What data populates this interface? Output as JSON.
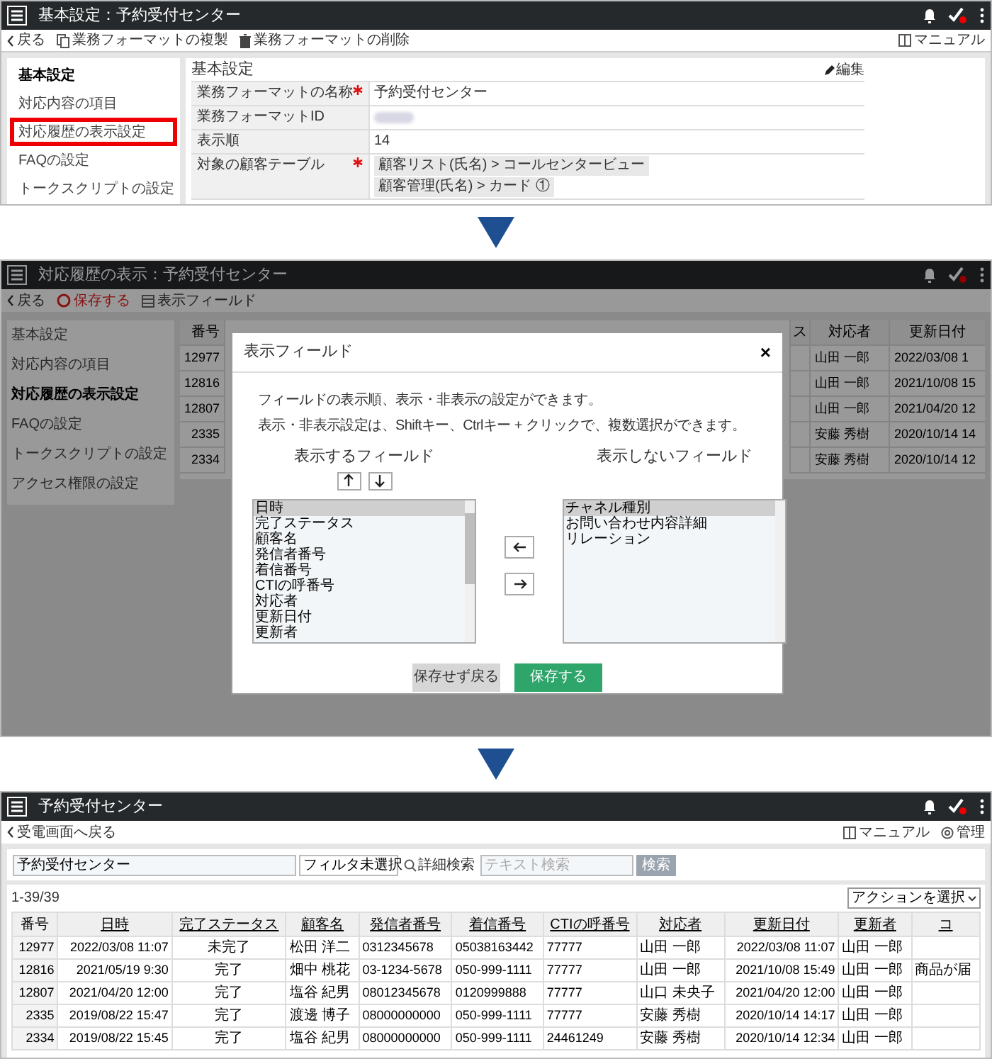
{
  "settings_screen": {
    "title": "基本設定：予約受付センター",
    "toolbar": [
      {
        "label": "戻る",
        "kind": "back"
      },
      {
        "label": "業務フォーマットの複製",
        "kind": "copy"
      },
      {
        "label": "業務フォーマットの削除",
        "kind": "delete"
      }
    ],
    "manual_link": "マニュアル",
    "sidebar": [
      {
        "label": "基本設定",
        "selected": true,
        "highlighted": false
      },
      {
        "label": "対応内容の項目",
        "selected": false,
        "highlighted": false
      },
      {
        "label": "対応履歴の表示設定",
        "selected": false,
        "highlighted": true
      },
      {
        "label": "FAQの設定",
        "selected": false,
        "highlighted": false
      },
      {
        "label": "トークスクリプトの設定",
        "selected": false,
        "highlighted": false
      }
    ],
    "section_title": "基本設定",
    "edit_link": "編集",
    "fields": [
      {
        "label": "業務フォーマットの名称",
        "required": true,
        "redacted": false,
        "values": [
          "予約受付センター"
        ]
      },
      {
        "label": "業務フォーマットID",
        "required": false,
        "redacted": true
      },
      {
        "label": "表示順",
        "required": false,
        "redacted": false,
        "values": [
          "14"
        ]
      },
      {
        "label": "対象の顧客テーブル",
        "required": true,
        "redacted": false,
        "values": [
          "顧客リスト(氏名) > コールセンタービュー",
          "顧客管理(氏名) > カード ①"
        ]
      }
    ]
  },
  "display_dialog_screen": {
    "title": "対応履歴の表示：予約受付センター",
    "toolbar": [
      {
        "label": "戻る",
        "kind": "back"
      },
      {
        "label": "保存する",
        "kind": "save"
      },
      {
        "label": "表示フィールド",
        "kind": "fields"
      }
    ],
    "sidebar": [
      {
        "label": "基本設定",
        "selected": false
      },
      {
        "label": "対応内容の項目",
        "selected": false
      },
      {
        "label": "対応履歴の表示設定",
        "selected": true
      },
      {
        "label": "FAQの設定",
        "selected": false
      },
      {
        "label": "トークスクリプトの設定",
        "selected": false
      },
      {
        "label": "アクセス権限の設定",
        "selected": false
      }
    ],
    "table": {
      "columns": [
        "番号",
        "ス",
        "対応者",
        "更新日付"
      ],
      "rows": [
        [
          "12977",
          "",
          "山田 一郎",
          "2022/03/08 1"
        ],
        [
          "12816",
          "",
          "山田 一郎",
          "2021/10/08 15"
        ],
        [
          "12807",
          "",
          "山田 一郎",
          "2021/04/20 12"
        ],
        [
          "2335",
          "",
          "安藤 秀樹",
          "2020/10/14 14"
        ],
        [
          "2334",
          "",
          "安藤 秀樹",
          "2020/10/14 12"
        ]
      ]
    },
    "dialog": {
      "title": "表示フィールド",
      "close": "×",
      "description": [
        "フィールドの表示順、表示・非表示の設定ができます。",
        "表示・非表示設定は、Shiftキー、Ctrlキー + クリックで、複数選択ができます。"
      ],
      "shown_heading": "表示するフィールド",
      "hidden_heading": "表示しないフィールド",
      "shown_fields": [
        {
          "label": "日時",
          "selected": true
        },
        {
          "label": "完了ステータス",
          "selected": false
        },
        {
          "label": "顧客名",
          "selected": false
        },
        {
          "label": "発信者番号",
          "selected": false
        },
        {
          "label": "着信番号",
          "selected": false
        },
        {
          "label": "CTIの呼番号",
          "selected": false
        },
        {
          "label": "対応者",
          "selected": false
        },
        {
          "label": "更新日付",
          "selected": false
        },
        {
          "label": "更新者",
          "selected": false
        }
      ],
      "hidden_fields": [
        {
          "label": "チャネル種別",
          "selected": true
        },
        {
          "label": "お問い合わせ内容詳細",
          "selected": false
        },
        {
          "label": "リレーション",
          "selected": false
        }
      ],
      "cancel_button": "保存せず戻る",
      "save_button": "保存する"
    }
  },
  "list_screen": {
    "title": "予約受付センター",
    "back_link": "受電画面へ戻る",
    "links": [
      {
        "label": "マニュアル",
        "kind": "manual"
      },
      {
        "label": "管理",
        "kind": "admin"
      }
    ],
    "search": {
      "value": "予約受付センター",
      "filter": "フィルタ未選択",
      "advanced_link": "詳細検索",
      "text_placeholder": "テキスト検索",
      "button": "検索"
    },
    "count": "1-39/39",
    "action_select": "アクションを選択",
    "table": {
      "columns": [
        {
          "label": "番号",
          "sortable": false,
          "kind": "number"
        },
        {
          "label": "日時",
          "sortable": true,
          "kind": "date"
        },
        {
          "label": "完了ステータス",
          "sortable": true,
          "kind": "status"
        },
        {
          "label": "顧客名",
          "sortable": true,
          "kind": "text"
        },
        {
          "label": "発信者番号",
          "sortable": true,
          "kind": "text"
        },
        {
          "label": "着信番号",
          "sortable": true,
          "kind": "text"
        },
        {
          "label": "CTIの呼番号",
          "sortable": true,
          "kind": "text"
        },
        {
          "label": "対応者",
          "sortable": true,
          "kind": "text"
        },
        {
          "label": "更新日付",
          "sortable": true,
          "kind": "date"
        },
        {
          "label": "更新者",
          "sortable": true,
          "kind": "text"
        },
        {
          "label": "コ",
          "sortable": true,
          "kind": "text"
        }
      ],
      "rows": [
        [
          "12977",
          "2022/03/08 11:07",
          "未完了",
          "松田 洋二",
          "0312345678",
          "05038163442",
          "77777",
          "山田 一郎",
          "2022/03/08 11:07",
          "山田 一郎",
          ""
        ],
        [
          "12816",
          "2021/05/19 9:30",
          "完了",
          "畑中 桃花",
          "03-1234-5678",
          "050-999-1111",
          "77777",
          "山田 一郎",
          "2021/10/08 15:49",
          "山田 一郎",
          "商品が届"
        ],
        [
          "12807",
          "2021/04/20 12:00",
          "完了",
          "塩谷 紀男",
          "08012345678",
          "0120999888",
          "77777",
          "山口 未央子",
          "2021/04/20 12:00",
          "山田 一郎",
          ""
        ],
        [
          "2335",
          "2019/08/22 15:47",
          "完了",
          "渡邊 博子",
          "08000000000",
          "050-999-1111",
          "77777",
          "安藤 秀樹",
          "2020/10/14 14:17",
          "山田 一郎",
          ""
        ],
        [
          "2334",
          "2019/08/22 15:45",
          "完了",
          "塩谷 紀男",
          "08000000000",
          "050-999-1111",
          "24461249",
          "安藤 秀樹",
          "2020/10/14 12:34",
          "山田 一郎",
          ""
        ]
      ]
    }
  }
}
